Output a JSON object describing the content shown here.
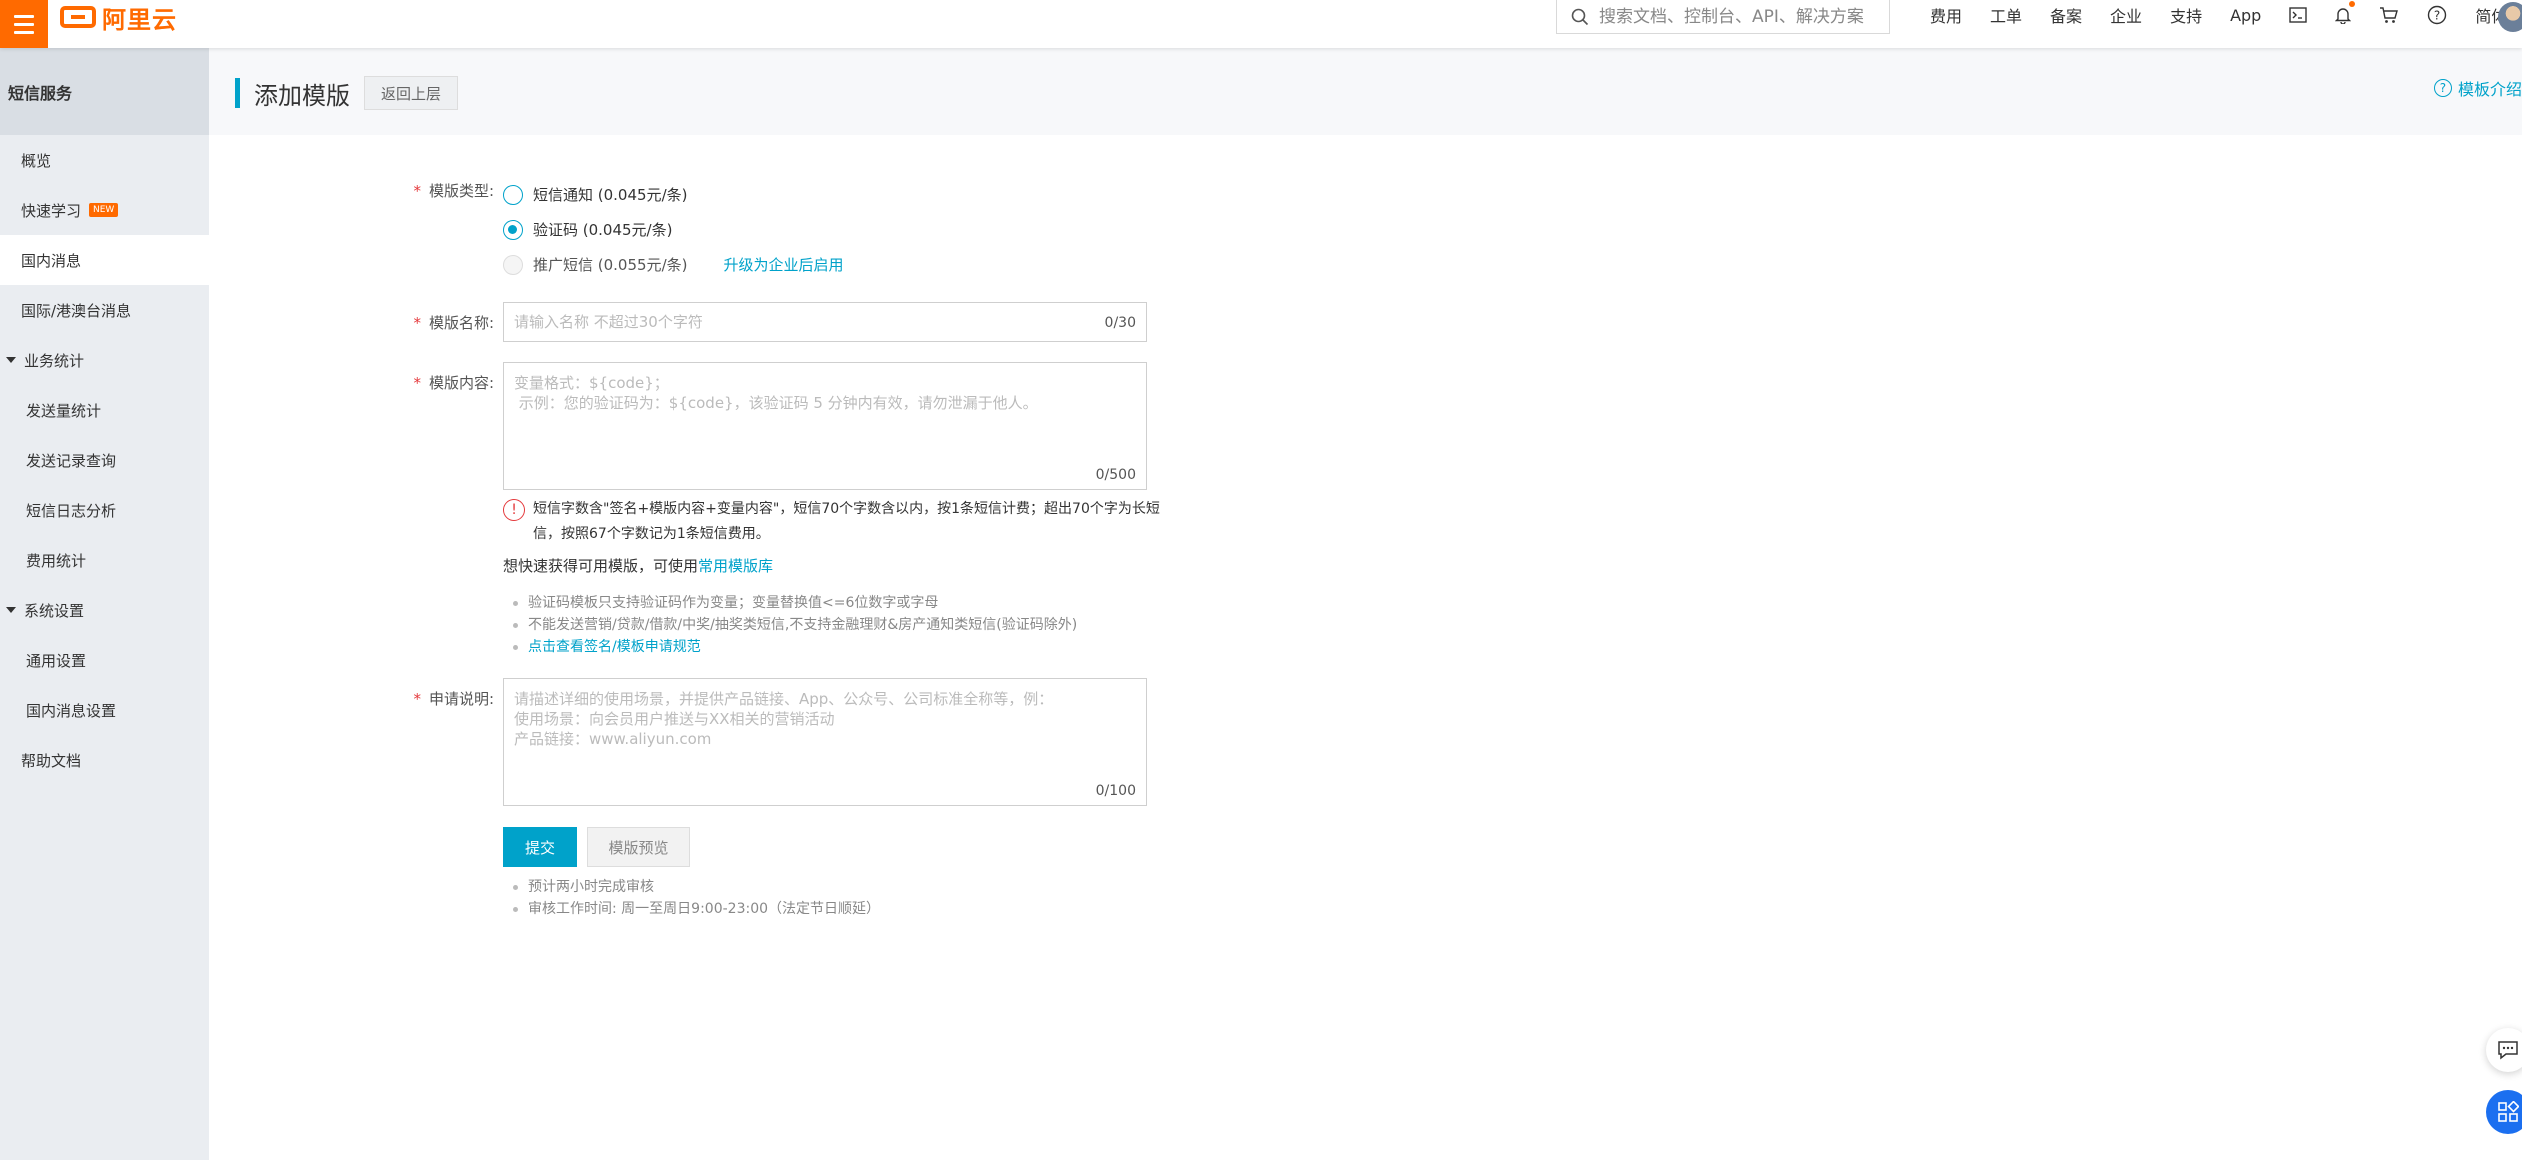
{
  "topbar": {
    "logo_text": "阿里云",
    "search_placeholder": "搜索文档、控制台、API、解决方案",
    "nav": [
      "费用",
      "工单",
      "备案",
      "企业",
      "支持",
      "App"
    ],
    "lang": "简体",
    "brand_color": "#ff6a00"
  },
  "sidebar": {
    "title": "短信服务",
    "items": [
      {
        "label": "概览"
      },
      {
        "label": "快速学习",
        "badge": "NEW"
      },
      {
        "label": "国内消息"
      },
      {
        "label": "国际/港澳台消息"
      },
      {
        "label": "业务统计"
      },
      {
        "label": "发送量统计"
      },
      {
        "label": "发送记录查询"
      },
      {
        "label": "短信日志分析"
      },
      {
        "label": "费用统计"
      },
      {
        "label": "系统设置"
      },
      {
        "label": "通用设置"
      },
      {
        "label": "国内消息设置"
      },
      {
        "label": "帮助文档"
      }
    ]
  },
  "header": {
    "title": "添加模版",
    "back_label": "返回上层",
    "help_label": "模板介绍",
    "accent_color": "#00a2ca"
  },
  "form": {
    "type_label": "模版类型:",
    "type_options": [
      {
        "label": "短信通知 (0.045元/条)",
        "checked": false,
        "disabled": false
      },
      {
        "label": "验证码 (0.045元/条)",
        "checked": true,
        "disabled": false
      },
      {
        "label": "推广短信 (0.055元/条)",
        "checked": false,
        "disabled": true
      }
    ],
    "upgrade_link": "升级为企业后启用",
    "name_label": "模版名称:",
    "name_placeholder": "请输入名称 不超过30个字符",
    "name_counter": "0/30",
    "content_label": "模版内容:",
    "content_placeholder": "变量格式：${code}；\n 示例：您的验证码为：${code}，该验证码 5 分钟内有效，请勿泄漏于他人。",
    "content_counter": "0/500",
    "content_hint": "短信字数含\"签名+模版内容+变量内容\"，短信70个字数含以内，按1条短信计费；超出70个字为长短信，按照67个字数记为1条短信费用。",
    "quick_text": "想快速获得可用模版，可使用",
    "quick_link": "常用模版库",
    "rules": [
      "验证码模板只支持验证码作为变量；变量替换值<=6位数字或字母",
      "不能发送营销/贷款/借款/中奖/抽奖类短信,不支持金融理财&房产通知类短信(验证码除外)"
    ],
    "rules_link": "点击查看签名/模板申请规范",
    "desc_label": "申请说明:",
    "desc_placeholder": "请描述详细的使用场景，并提供产品链接、App、公众号、公司标准全称等，例：\n使用场景：向会员用户推送与XX相关的营销活动\n产品链接：www.aliyun.com",
    "desc_counter": "0/100",
    "submit_label": "提交",
    "preview_label": "模版预览",
    "notes": [
      "预计两小时完成审核",
      "审核工作时间: 周一至周日9:00-23:00（法定节日顺延）"
    ]
  }
}
